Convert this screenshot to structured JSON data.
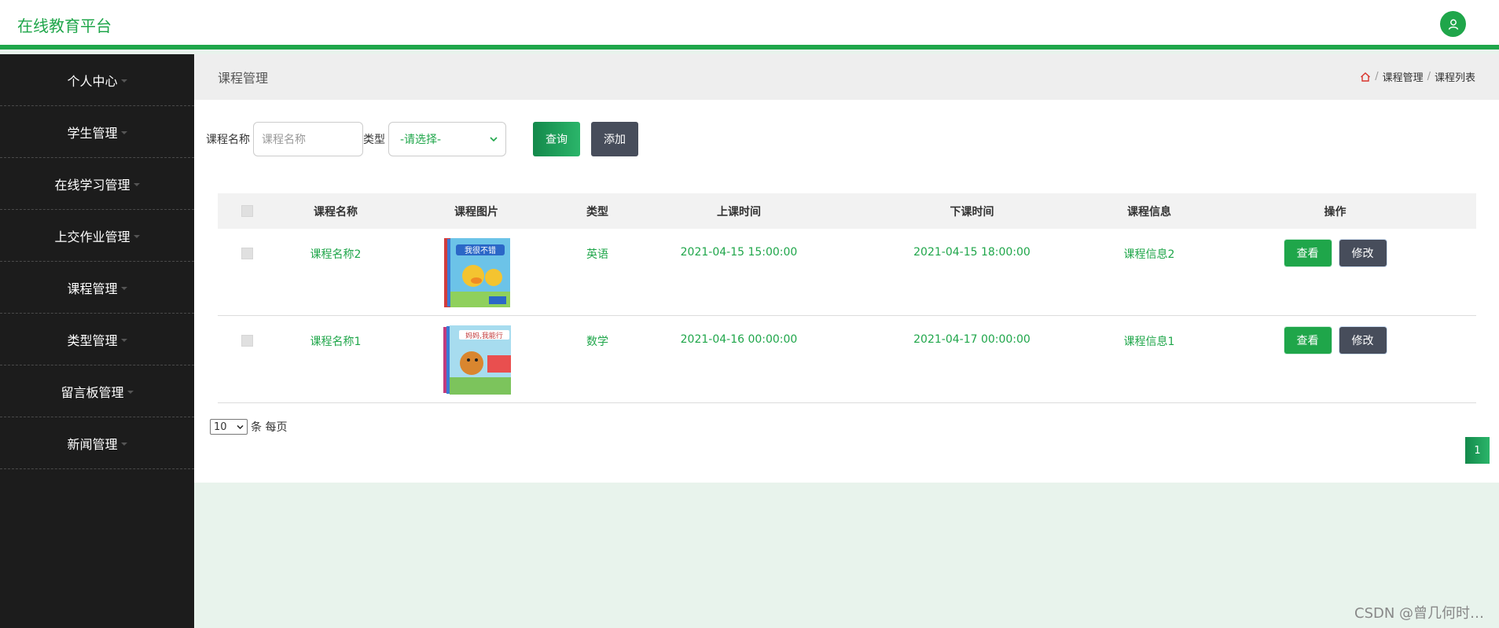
{
  "brand": "在线教育平台",
  "sidebar": {
    "items": [
      {
        "label": "个人中心"
      },
      {
        "label": "学生管理"
      },
      {
        "label": "在线学习管理"
      },
      {
        "label": "上交作业管理"
      },
      {
        "label": "课程管理"
      },
      {
        "label": "类型管理"
      },
      {
        "label": "留言板管理"
      },
      {
        "label": "新闻管理"
      }
    ]
  },
  "header": {
    "title": "课程管理",
    "breadcrumb": [
      "课程管理",
      "课程列表"
    ]
  },
  "search": {
    "name_label": "课程名称",
    "name_placeholder": "课程名称",
    "type_label": "类型",
    "type_value": "-请选择-",
    "search_button": "查询",
    "add_button": "添加"
  },
  "table": {
    "headers": [
      "课程名称",
      "课程图片",
      "类型",
      "上课时间",
      "下课时间",
      "课程信息",
      "操作"
    ],
    "rows": [
      {
        "name": "课程名称2",
        "type": "英语",
        "start": "2021-04-15 15:00:00",
        "end": "2021-04-15 18:00:00",
        "info": "课程信息2",
        "view": "查看",
        "edit": "修改"
      },
      {
        "name": "课程名称1",
        "type": "数学",
        "start": "2021-04-16 00:00:00",
        "end": "2021-04-17 00:00:00",
        "info": "课程信息1",
        "view": "查看",
        "edit": "修改"
      }
    ]
  },
  "pager": {
    "page_size": "10",
    "page_size_suffix": "条 每页",
    "current_page": "1"
  },
  "watermark": "CSDN @曾几何时…",
  "colors": {
    "accent": "#1fa64a",
    "sidebar_bg": "#1c1c1c",
    "dark_button": "#474d5b"
  }
}
